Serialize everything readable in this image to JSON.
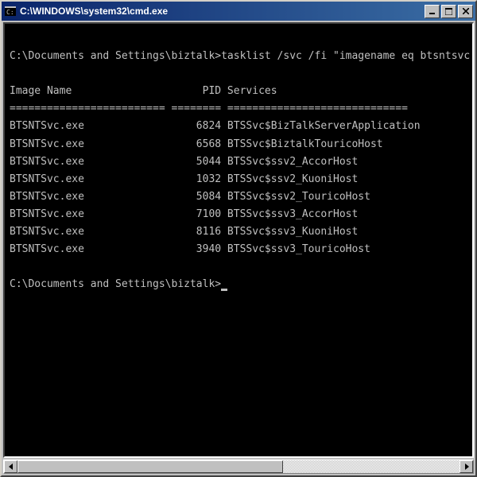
{
  "window": {
    "title": "C:\\WINDOWS\\system32\\cmd.exe"
  },
  "console": {
    "prompt1_path": "C:\\Documents and Settings\\biztalk>",
    "command": "tasklist /svc /fi \"imagename eq btsntsvc.exe\"",
    "header_image": "Image Name",
    "header_pid": "PID",
    "header_services": "Services",
    "sep_image": "=========================",
    "sep_pid": "========",
    "sep_services": "=============================",
    "rows": [
      {
        "image": "BTSNTSvc.exe",
        "pid": "6824",
        "services": "BTSSvc$BizTalkServerApplication"
      },
      {
        "image": "BTSNTSvc.exe",
        "pid": "6568",
        "services": "BTSSvc$BiztalkTouricoHost"
      },
      {
        "image": "BTSNTSvc.exe",
        "pid": "5044",
        "services": "BTSSvc$ssv2_AccorHost"
      },
      {
        "image": "BTSNTSvc.exe",
        "pid": "1032",
        "services": "BTSSvc$ssv2_KuoniHost"
      },
      {
        "image": "BTSNTSvc.exe",
        "pid": "5084",
        "services": "BTSSvc$ssv2_TouricoHost"
      },
      {
        "image": "BTSNTSvc.exe",
        "pid": "7100",
        "services": "BTSSvc$ssv3_AccorHost"
      },
      {
        "image": "BTSNTSvc.exe",
        "pid": "8116",
        "services": "BTSSvc$ssv3_KuoniHost"
      },
      {
        "image": "BTSNTSvc.exe",
        "pid": "3940",
        "services": "BTSSvc$ssv3_TouricoHost"
      }
    ],
    "prompt2_path": "C:\\Documents and Settings\\biztalk>"
  }
}
